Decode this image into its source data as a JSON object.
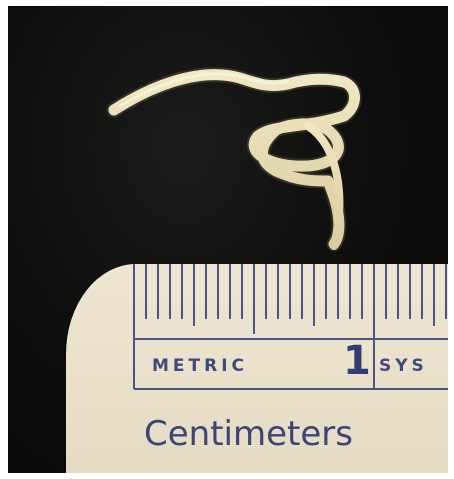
{
  "scene": {
    "subject": "worm-specimen",
    "background_color": "#0d0d0c",
    "worm_color": "#e8dcb4"
  },
  "ruler": {
    "metric_label": "METRIC",
    "numeral": "1",
    "system_label": "SYS",
    "units_label": "Centimeters",
    "ink_color": "#3f4a7a",
    "paper_color": "#ece3cd"
  }
}
